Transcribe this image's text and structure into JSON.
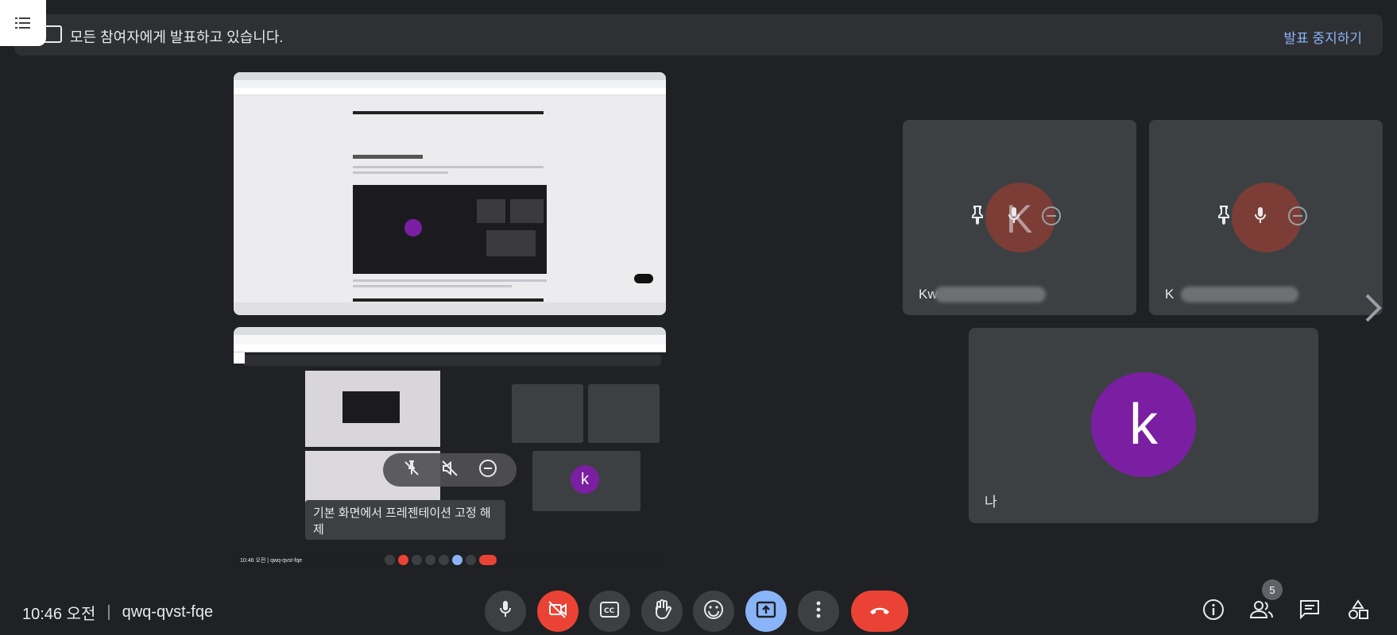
{
  "banner": {
    "text": "모든 참여자에게 발표하고 있습니다.",
    "stop_label": "발표 중지하기"
  },
  "shared_screen": {
    "preview_tooltip": "기본 화면에서 프레젠테이션 고정 해제",
    "inner_time": "10:46 오전",
    "inner_meeting_code": "qwq-qvst-fqe",
    "inner_avatar_letter": "k"
  },
  "participants": [
    {
      "name_visible": "Kw",
      "name_rest_obscured": true,
      "initial": "K"
    },
    {
      "name_visible": "K",
      "name_rest_obscured": true,
      "initial": "K"
    },
    {
      "name": "나",
      "initial": "k",
      "avatar_color": "#7b1fa2"
    }
  ],
  "bottom_bar": {
    "time": "10:46 오전",
    "meeting_code": "qwq-qvst-fqe",
    "participant_count": "5"
  },
  "colors": {
    "background": "#202124",
    "tile": "#3c4043",
    "accent": "#8ab4f8",
    "danger": "#ea4335",
    "avatar": "#7b1fa2"
  },
  "icons": {
    "menu": "menu-list-icon",
    "present": "present-screen-icon",
    "pin": "pin-icon",
    "mic": "mic-icon",
    "remove": "remove-icon",
    "next": "chevron-right-icon",
    "camera_off": "camera-off-icon",
    "captions": "captions-icon",
    "raise_hand": "raise-hand-icon",
    "emoji": "emoji-icon",
    "present_now": "present-now-icon",
    "more": "more-options-icon",
    "end_call": "end-call-icon",
    "info": "info-icon",
    "people": "people-icon",
    "chat": "chat-icon",
    "activities": "activities-icon"
  }
}
